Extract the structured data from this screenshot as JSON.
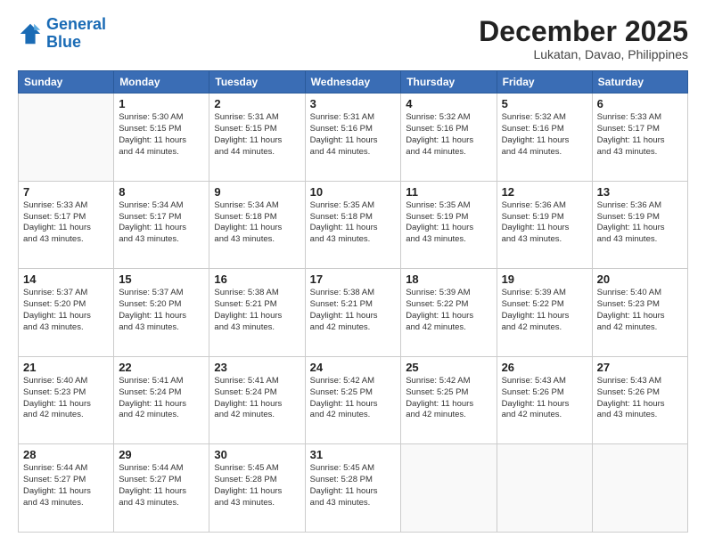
{
  "logo": {
    "line1": "General",
    "line2": "Blue"
  },
  "header": {
    "month_year": "December 2025",
    "location": "Lukatan, Davao, Philippines"
  },
  "weekdays": [
    "Sunday",
    "Monday",
    "Tuesday",
    "Wednesday",
    "Thursday",
    "Friday",
    "Saturday"
  ],
  "weeks": [
    [
      {
        "day": "",
        "lines": []
      },
      {
        "day": "1",
        "lines": [
          "Sunrise: 5:30 AM",
          "Sunset: 5:15 PM",
          "Daylight: 11 hours",
          "and 44 minutes."
        ]
      },
      {
        "day": "2",
        "lines": [
          "Sunrise: 5:31 AM",
          "Sunset: 5:15 PM",
          "Daylight: 11 hours",
          "and 44 minutes."
        ]
      },
      {
        "day": "3",
        "lines": [
          "Sunrise: 5:31 AM",
          "Sunset: 5:16 PM",
          "Daylight: 11 hours",
          "and 44 minutes."
        ]
      },
      {
        "day": "4",
        "lines": [
          "Sunrise: 5:32 AM",
          "Sunset: 5:16 PM",
          "Daylight: 11 hours",
          "and 44 minutes."
        ]
      },
      {
        "day": "5",
        "lines": [
          "Sunrise: 5:32 AM",
          "Sunset: 5:16 PM",
          "Daylight: 11 hours",
          "and 44 minutes."
        ]
      },
      {
        "day": "6",
        "lines": [
          "Sunrise: 5:33 AM",
          "Sunset: 5:17 PM",
          "Daylight: 11 hours",
          "and 43 minutes."
        ]
      }
    ],
    [
      {
        "day": "7",
        "lines": [
          "Sunrise: 5:33 AM",
          "Sunset: 5:17 PM",
          "Daylight: 11 hours",
          "and 43 minutes."
        ]
      },
      {
        "day": "8",
        "lines": [
          "Sunrise: 5:34 AM",
          "Sunset: 5:17 PM",
          "Daylight: 11 hours",
          "and 43 minutes."
        ]
      },
      {
        "day": "9",
        "lines": [
          "Sunrise: 5:34 AM",
          "Sunset: 5:18 PM",
          "Daylight: 11 hours",
          "and 43 minutes."
        ]
      },
      {
        "day": "10",
        "lines": [
          "Sunrise: 5:35 AM",
          "Sunset: 5:18 PM",
          "Daylight: 11 hours",
          "and 43 minutes."
        ]
      },
      {
        "day": "11",
        "lines": [
          "Sunrise: 5:35 AM",
          "Sunset: 5:19 PM",
          "Daylight: 11 hours",
          "and 43 minutes."
        ]
      },
      {
        "day": "12",
        "lines": [
          "Sunrise: 5:36 AM",
          "Sunset: 5:19 PM",
          "Daylight: 11 hours",
          "and 43 minutes."
        ]
      },
      {
        "day": "13",
        "lines": [
          "Sunrise: 5:36 AM",
          "Sunset: 5:19 PM",
          "Daylight: 11 hours",
          "and 43 minutes."
        ]
      }
    ],
    [
      {
        "day": "14",
        "lines": [
          "Sunrise: 5:37 AM",
          "Sunset: 5:20 PM",
          "Daylight: 11 hours",
          "and 43 minutes."
        ]
      },
      {
        "day": "15",
        "lines": [
          "Sunrise: 5:37 AM",
          "Sunset: 5:20 PM",
          "Daylight: 11 hours",
          "and 43 minutes."
        ]
      },
      {
        "day": "16",
        "lines": [
          "Sunrise: 5:38 AM",
          "Sunset: 5:21 PM",
          "Daylight: 11 hours",
          "and 43 minutes."
        ]
      },
      {
        "day": "17",
        "lines": [
          "Sunrise: 5:38 AM",
          "Sunset: 5:21 PM",
          "Daylight: 11 hours",
          "and 42 minutes."
        ]
      },
      {
        "day": "18",
        "lines": [
          "Sunrise: 5:39 AM",
          "Sunset: 5:22 PM",
          "Daylight: 11 hours",
          "and 42 minutes."
        ]
      },
      {
        "day": "19",
        "lines": [
          "Sunrise: 5:39 AM",
          "Sunset: 5:22 PM",
          "Daylight: 11 hours",
          "and 42 minutes."
        ]
      },
      {
        "day": "20",
        "lines": [
          "Sunrise: 5:40 AM",
          "Sunset: 5:23 PM",
          "Daylight: 11 hours",
          "and 42 minutes."
        ]
      }
    ],
    [
      {
        "day": "21",
        "lines": [
          "Sunrise: 5:40 AM",
          "Sunset: 5:23 PM",
          "Daylight: 11 hours",
          "and 42 minutes."
        ]
      },
      {
        "day": "22",
        "lines": [
          "Sunrise: 5:41 AM",
          "Sunset: 5:24 PM",
          "Daylight: 11 hours",
          "and 42 minutes."
        ]
      },
      {
        "day": "23",
        "lines": [
          "Sunrise: 5:41 AM",
          "Sunset: 5:24 PM",
          "Daylight: 11 hours",
          "and 42 minutes."
        ]
      },
      {
        "day": "24",
        "lines": [
          "Sunrise: 5:42 AM",
          "Sunset: 5:25 PM",
          "Daylight: 11 hours",
          "and 42 minutes."
        ]
      },
      {
        "day": "25",
        "lines": [
          "Sunrise: 5:42 AM",
          "Sunset: 5:25 PM",
          "Daylight: 11 hours",
          "and 42 minutes."
        ]
      },
      {
        "day": "26",
        "lines": [
          "Sunrise: 5:43 AM",
          "Sunset: 5:26 PM",
          "Daylight: 11 hours",
          "and 42 minutes."
        ]
      },
      {
        "day": "27",
        "lines": [
          "Sunrise: 5:43 AM",
          "Sunset: 5:26 PM",
          "Daylight: 11 hours",
          "and 43 minutes."
        ]
      }
    ],
    [
      {
        "day": "28",
        "lines": [
          "Sunrise: 5:44 AM",
          "Sunset: 5:27 PM",
          "Daylight: 11 hours",
          "and 43 minutes."
        ]
      },
      {
        "day": "29",
        "lines": [
          "Sunrise: 5:44 AM",
          "Sunset: 5:27 PM",
          "Daylight: 11 hours",
          "and 43 minutes."
        ]
      },
      {
        "day": "30",
        "lines": [
          "Sunrise: 5:45 AM",
          "Sunset: 5:28 PM",
          "Daylight: 11 hours",
          "and 43 minutes."
        ]
      },
      {
        "day": "31",
        "lines": [
          "Sunrise: 5:45 AM",
          "Sunset: 5:28 PM",
          "Daylight: 11 hours",
          "and 43 minutes."
        ]
      },
      {
        "day": "",
        "lines": []
      },
      {
        "day": "",
        "lines": []
      },
      {
        "day": "",
        "lines": []
      }
    ]
  ]
}
